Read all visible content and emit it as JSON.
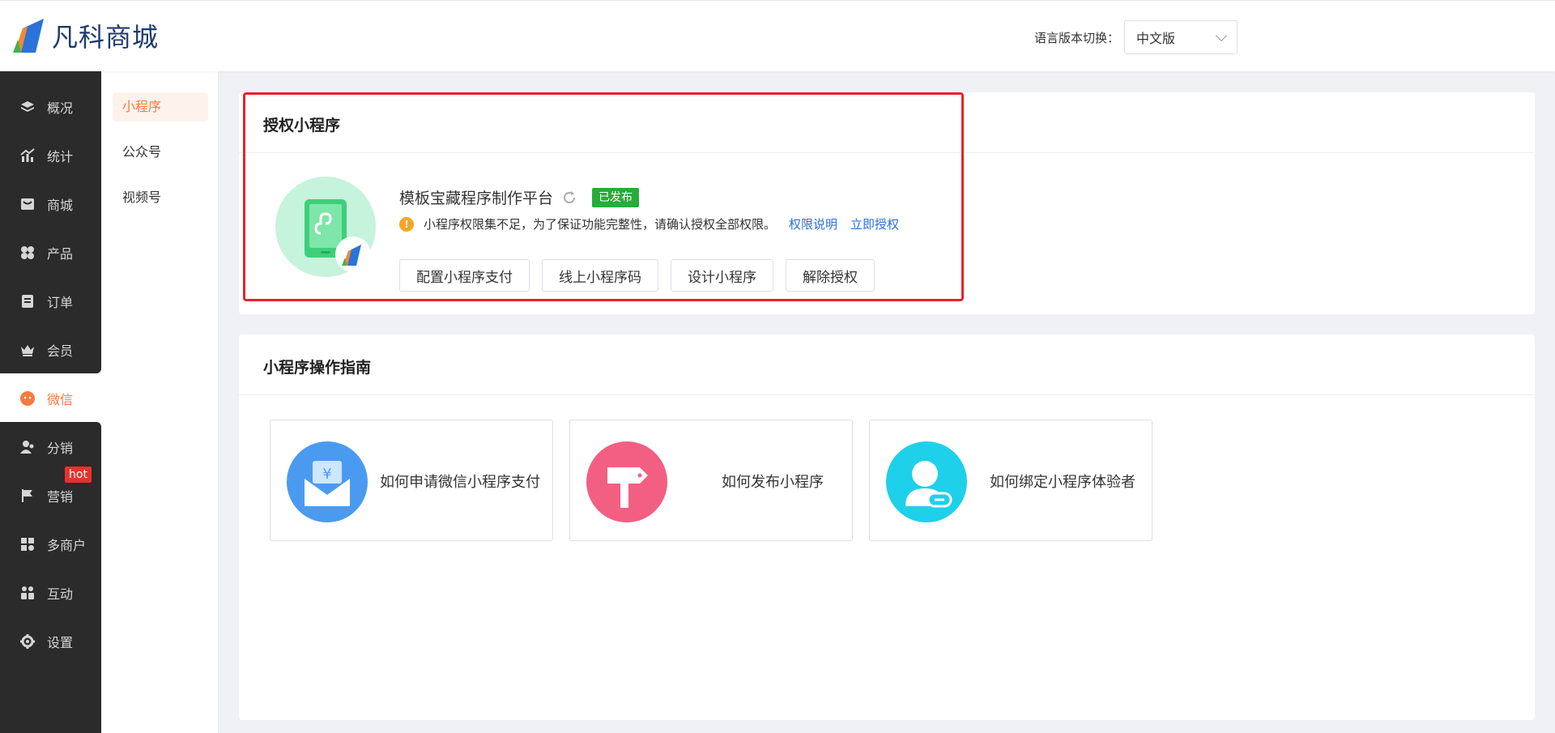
{
  "header": {
    "logo_text": "凡科商城",
    "lang_label": "语言版本切换：",
    "lang_value": "中文版"
  },
  "sidebar": {
    "items": [
      {
        "label": "概况",
        "icon": "layers-icon"
      },
      {
        "label": "统计",
        "icon": "chart-icon"
      },
      {
        "label": "商城",
        "icon": "store-icon"
      },
      {
        "label": "产品",
        "icon": "product-icon"
      },
      {
        "label": "订单",
        "icon": "order-icon"
      },
      {
        "label": "会员",
        "icon": "crown-icon"
      },
      {
        "label": "微信",
        "icon": "wechat-icon"
      },
      {
        "label": "分销",
        "icon": "distribution-icon"
      },
      {
        "label": "营销",
        "icon": "flag-icon"
      },
      {
        "label": "多商户",
        "icon": "multi-merchant-icon"
      },
      {
        "label": "互动",
        "icon": "interact-icon"
      },
      {
        "label": "设置",
        "icon": "gear-icon"
      }
    ],
    "hot_badge": "hot",
    "active_color": "#f47b3f"
  },
  "subsidebar": {
    "items": [
      {
        "label": "小程序"
      },
      {
        "label": "公众号"
      },
      {
        "label": "视频号"
      }
    ]
  },
  "auth_card": {
    "title": "授权小程序",
    "app_name": "模板宝藏程序制作平台",
    "status": "已发布",
    "warning": "小程序权限集不足，为了保证功能完整性，请确认授权全部权限。",
    "link_explain": "权限说明",
    "link_authorize": "立即授权",
    "buttons": [
      {
        "label": "配置小程序支付"
      },
      {
        "label": "线上小程序码"
      },
      {
        "label": "设计小程序"
      },
      {
        "label": "解除授权"
      }
    ]
  },
  "guide_card": {
    "title": "小程序操作指南",
    "items": [
      {
        "label": "如何申请微信小程序支付",
        "icon": "payment-envelope-icon"
      },
      {
        "label": "如何发布小程序",
        "icon": "signpost-icon"
      },
      {
        "label": "如何绑定小程序体验者",
        "icon": "user-link-icon"
      }
    ]
  },
  "colors": {
    "accent": "#f47b3f",
    "link": "#2d6fd6",
    "success": "#27ab3b",
    "highlight": "#e5242b"
  }
}
